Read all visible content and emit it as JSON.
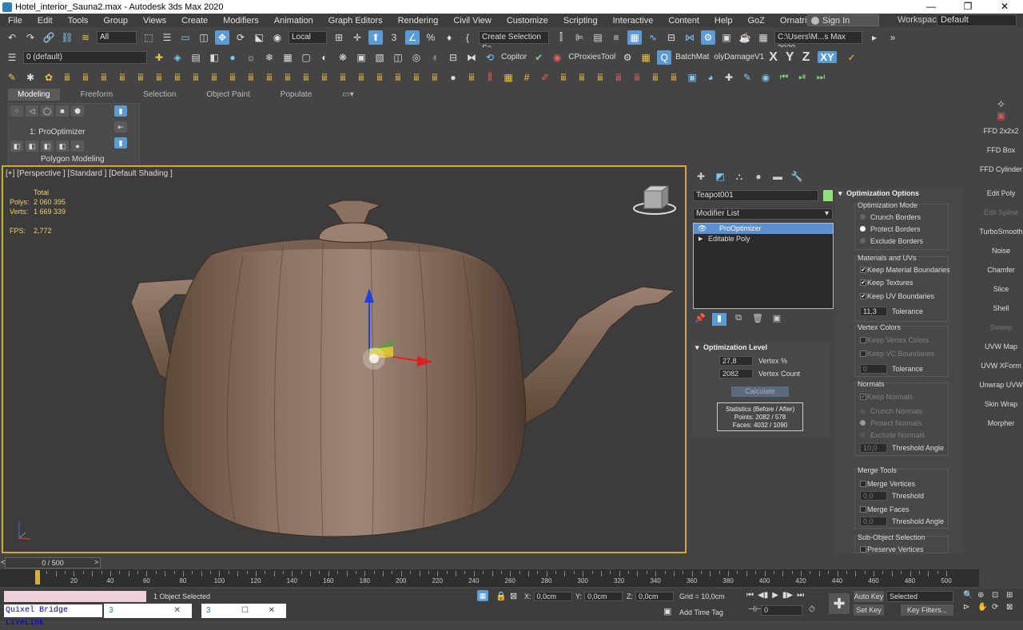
{
  "titlebar": {
    "title": "Hotel_interior_Sauna2.max - Autodesk 3ds Max 2020"
  },
  "menu": [
    "File",
    "Edit",
    "Tools",
    "Group",
    "Views",
    "Create",
    "Modifiers",
    "Animation",
    "Graph Editors",
    "Rendering",
    "Civil View",
    "Customize",
    "Scripting",
    "Interactive",
    "Content",
    "Help",
    "GoZ",
    "Ornatrix"
  ],
  "signin": "Sign In",
  "workspaces_label": "Workspaces:",
  "workspace": "Default",
  "toolbar1": {
    "filter": "All",
    "coordsys": "Local",
    "selset": "Create Selection Se",
    "path": "C:\\Users\\M...s Max 2020"
  },
  "toolbar2": {
    "layer": "0 (default)",
    "copitor": "Copitor",
    "cproxies": "CProxiesTool",
    "batchmat": "BatchMat",
    "polydamage": "olyDamageV1",
    "axes": [
      "X",
      "Y",
      "Z",
      "XY"
    ],
    "axis_active": "XY"
  },
  "ribbon": {
    "tabs": [
      "Modeling",
      "Freeform",
      "Selection",
      "Object Paint",
      "Populate"
    ],
    "active_tab": "Modeling",
    "modifier_label": "1: ProOptimizer",
    "panel_title": "Polygon Modeling"
  },
  "right_strip": [
    {
      "label": "FFD 2x2x2",
      "dim": false
    },
    {
      "label": "FFD Box",
      "dim": false
    },
    {
      "label": "FFD Cylinder",
      "dim": false
    },
    {
      "label": "Edit Poly",
      "dim": false
    },
    {
      "label": "Edit Spline",
      "dim": true
    },
    {
      "label": "TurboSmooth",
      "dim": false
    },
    {
      "label": "Noise",
      "dim": false
    },
    {
      "label": "Chamfer",
      "dim": false
    },
    {
      "label": "Slice",
      "dim": false
    },
    {
      "label": "Shell",
      "dim": false
    },
    {
      "label": "Sweep",
      "dim": true
    },
    {
      "label": "UVW Map",
      "dim": false
    },
    {
      "label": "UVW XForm",
      "dim": false
    },
    {
      "label": "Unwrap UVW",
      "dim": false
    },
    {
      "label": "Skin Wrap",
      "dim": false
    },
    {
      "label": "Morpher",
      "dim": false
    }
  ],
  "viewport": {
    "label": "[+] [Perspective ] [Standard ] [Default Shading ]",
    "stats": {
      "total": "Total",
      "polys_label": "Polys:",
      "polys": "2 060 395",
      "verts_label": "Verts:",
      "verts": "1 669 339",
      "fps_label": "FPS:",
      "fps": "2,772"
    }
  },
  "command_panel": {
    "object_name": "Teapot001",
    "modifier_list": "Modifier List",
    "stack": [
      "ProOptimizer",
      "Editable Poly"
    ],
    "optimization_level": {
      "title": "Optimization Level",
      "vertex_pct": "27,8",
      "vertex_pct_label": "Vertex %",
      "vertex_count": "2082",
      "vertex_count_label": "Vertex Count",
      "calculate": "Calculate",
      "stats_title": "Statistics (Before / After)",
      "points": "Points: 2082 / 578",
      "faces": "Faces: 4032 / 1090"
    },
    "options": {
      "title": "Optimization Options",
      "mode_label": "Optimization Mode",
      "modes": [
        "Crunch Borders",
        "Protect Borders",
        "Exclude Borders"
      ],
      "mode_selected": 1,
      "mat_label": "Materials and UVs",
      "mat_items": [
        "Keep Material Boundaries",
        "Keep Textures",
        "Keep UV Boundaries"
      ],
      "tolerance_value": "11,3",
      "tolerance_label": "Tolerance",
      "vc_label": "Vertex Colors",
      "vc_items": [
        "Keep Vertex Colors",
        "Keep VC Boundaries"
      ],
      "vc_tolerance": "0",
      "normals_label": "Normals",
      "keep_normals": "Keep Normals",
      "normal_modes": [
        "Crunch Normals",
        "Protect Normals",
        "Exclude Normals"
      ],
      "threshold_angle_value": "10,0",
      "threshold_angle_label": "Threshold Angle",
      "merge_label": "Merge Tools",
      "merge_vertices": "Merge Vertices",
      "threshold_value": "0,0",
      "threshold_label": "Threshold",
      "merge_faces": "Merge Faces",
      "merge_angle_value": "0,0",
      "merge_angle_label": "Threshold Angle",
      "subobj_label": "Sub-Object Selection",
      "preserve_vertices": "Preserve Vertices"
    }
  },
  "timeline": {
    "slider": "0 / 500",
    "ticks": [
      0,
      20,
      40,
      60,
      80,
      100,
      120,
      140,
      160,
      180,
      200,
      220,
      240,
      260,
      280,
      300,
      320,
      340,
      360,
      380,
      400,
      420,
      440,
      460,
      480,
      500
    ]
  },
  "status": {
    "quixel": "Quixel Bridge LiveLink",
    "selected": "1 Object Selected",
    "x_label": "X:",
    "x": "0,0cm",
    "y_label": "Y:",
    "y": "0,0cm",
    "z_label": "Z:",
    "z": "0,0cm",
    "grid": "Grid = 10,0cm",
    "add_time_tag": "Add Time Tag",
    "autokey": "Auto Key",
    "setkey": "Set Key",
    "selected_dd": "Selected",
    "keyfilters": "Key Filters...",
    "frame": "0"
  },
  "colors": {
    "accent": "#5b9bd5",
    "viewport_border": "#d4a82a",
    "stats": "#f0d060",
    "object_color": "#8fe07a"
  }
}
